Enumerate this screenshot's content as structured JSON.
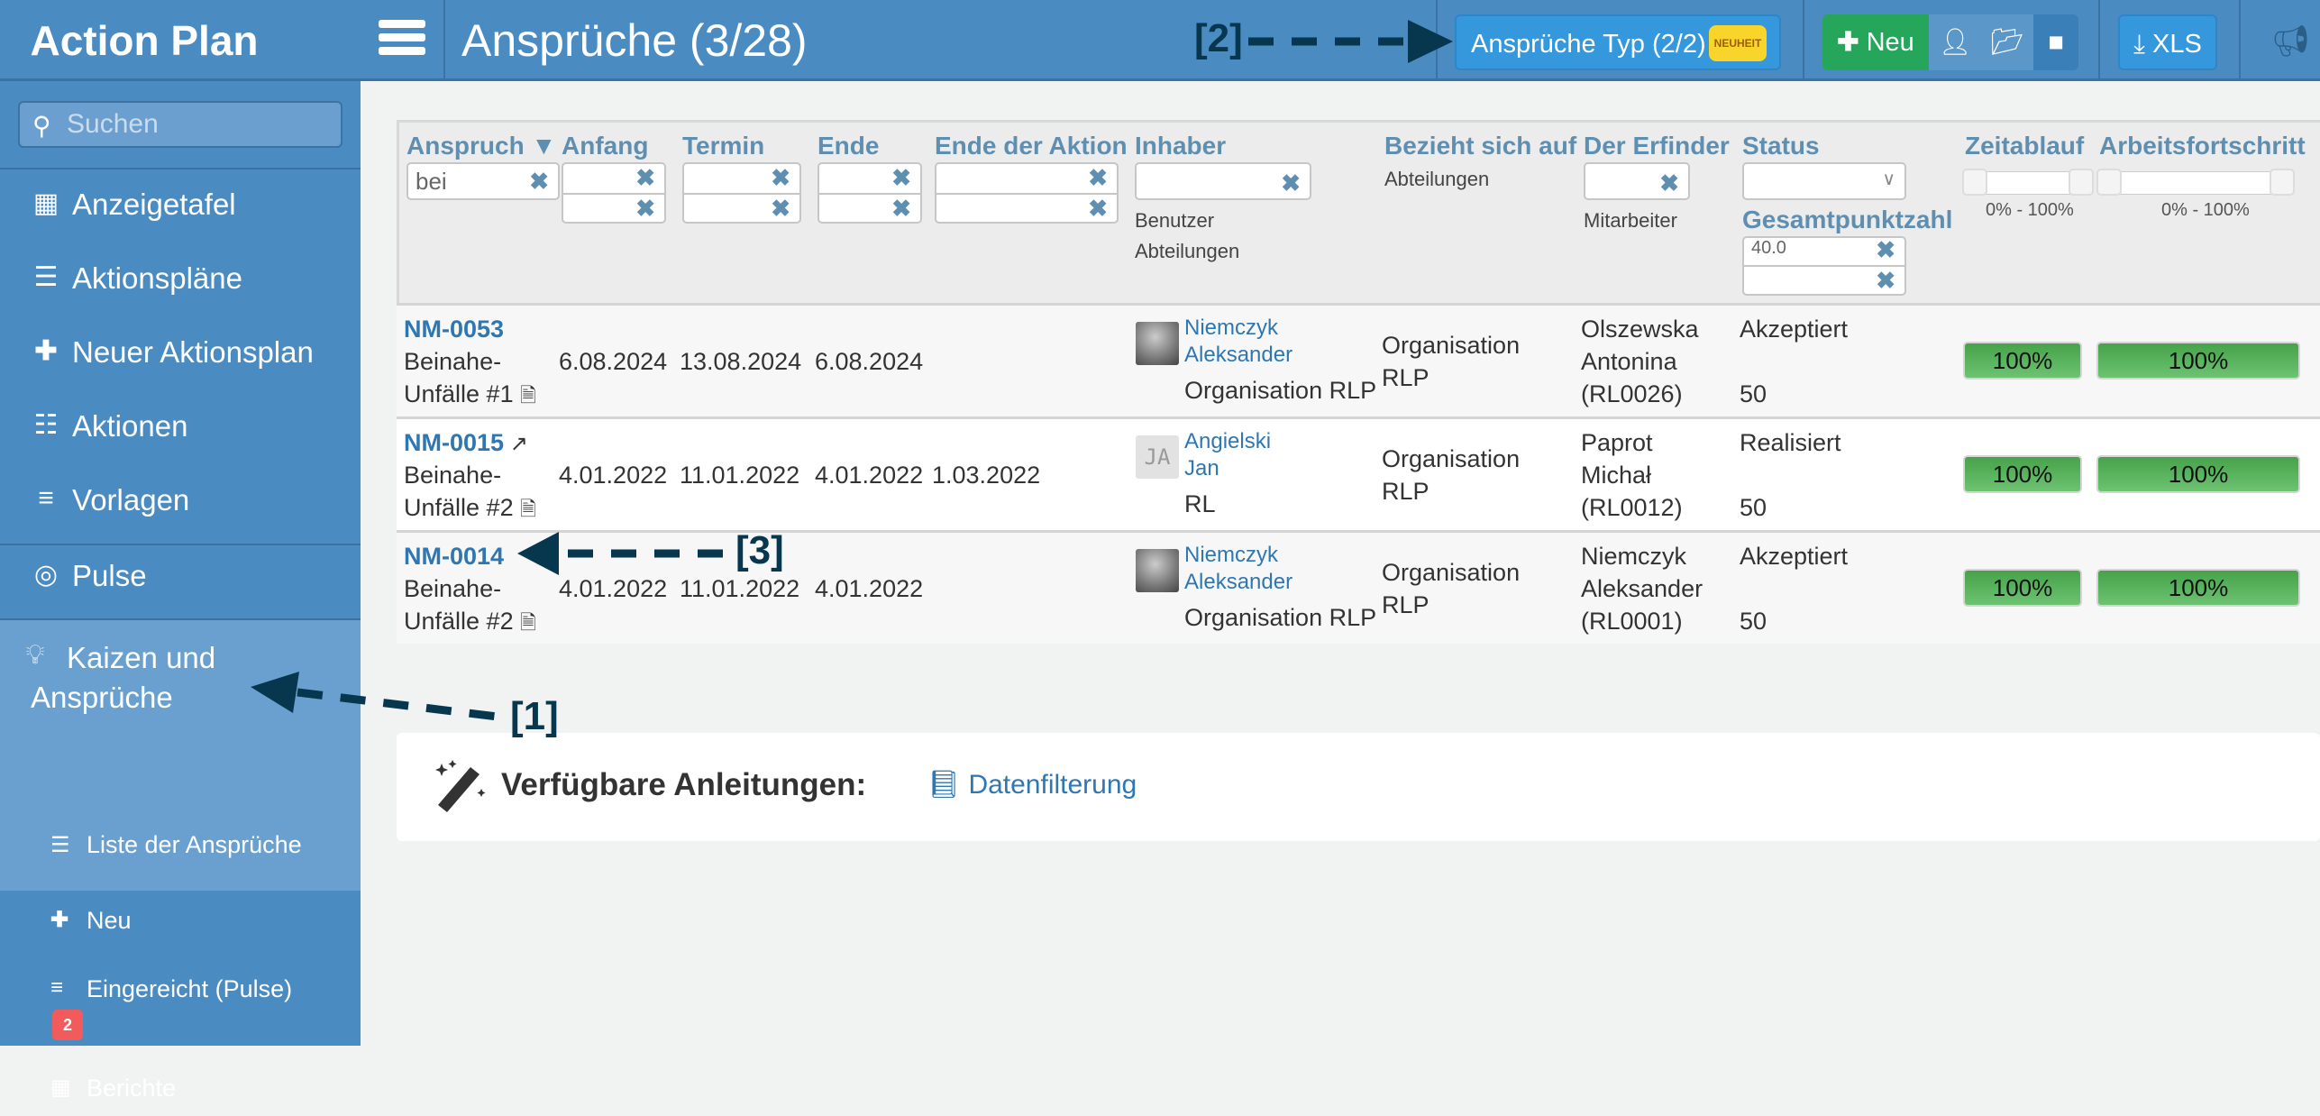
{
  "header": {
    "brand": "Action Plan",
    "page_title": "Ansprüche (3/28)",
    "type_button": "Ansprüche Typ (2/2)",
    "type_badge": "NEUHEIT",
    "new_button": "Neu",
    "xls_button": "XLS"
  },
  "sidebar": {
    "search_placeholder": "Suchen",
    "items": [
      {
        "label": "Anzeigetafel",
        "icon": "calendar-icon"
      },
      {
        "label": "Aktionspläne",
        "icon": "list-icon"
      },
      {
        "label": "Neuer Aktionsplan",
        "icon": "plus-icon"
      },
      {
        "label": "Aktionen",
        "icon": "sliders-icon"
      },
      {
        "label": "Vorlagen",
        "icon": "bars-icon"
      },
      {
        "label": "Pulse",
        "icon": "target-icon"
      },
      {
        "label": "Kaizen und Ansprüche",
        "icon": "lightbulb-icon"
      }
    ],
    "subitems": [
      {
        "label": "Liste der Ansprüche",
        "icon": "list-icon"
      },
      {
        "label": "Neu",
        "icon": "plus-icon"
      },
      {
        "label": "Eingereicht (Pulse)",
        "icon": "bars-icon",
        "badge": "2"
      },
      {
        "label": "Berichte",
        "icon": "table-icon"
      }
    ]
  },
  "table": {
    "columns": [
      "Anspruch ▼",
      "Anfang",
      "Termin",
      "Ende",
      "Ende der Aktion",
      "Inhaber",
      "Bezieht sich auf",
      "Der Erfinder",
      "Status",
      "Zeitablauf",
      "Arbeitsfortschritt"
    ],
    "filters": {
      "anspruch": "bei",
      "gesamtpunktzahl_label": "Gesamtpunktzahl",
      "gesamtpunktzahl_from": "40.0",
      "inhaber_sub1": "Benutzer",
      "inhaber_sub2": "Abteilungen",
      "bezieht_sub": "Abteilungen",
      "erfinder_sub": "Mitarbeiter",
      "zeitablauf_range": "0% - 100%",
      "arbeitsfortschritt_range": "0% - 100%"
    },
    "rows": [
      {
        "id": "NM-0053",
        "title_line1": "Beinahe-",
        "title_line2": "Unfälle #1",
        "anfang": "6.08.2024",
        "termin": "13.08.2024",
        "ende": "6.08.2024",
        "ende_aktion": "",
        "owner_last": "Niemczyk",
        "owner_first": "Aleksander",
        "owner_org": "Organisation RLP",
        "bezieht": "Organisation RLP",
        "inventor_line1": "Olszewska",
        "inventor_line2": "Antonina",
        "inventor_code": "(RL0026)",
        "status": "Akzeptiert",
        "score": "50",
        "time_progress": "100%",
        "work_progress": "100%"
      },
      {
        "id": "NM-0015",
        "title_line1": "Beinahe-",
        "title_line2": "Unfälle #2",
        "anfang": "4.01.2022",
        "termin": "11.01.2022",
        "ende": "4.01.2022",
        "ende_aktion": "1.03.2022",
        "owner_last": "Angielski",
        "owner_first": "Jan",
        "owner_org": "RL",
        "owner_initials": "JA",
        "bezieht": "Organisation RLP",
        "inventor_line1": "Paprot",
        "inventor_line2": "Michał",
        "inventor_code": "(RL0012)",
        "status": "Realisiert",
        "score": "50",
        "time_progress": "100%",
        "work_progress": "100%"
      },
      {
        "id": "NM-0014",
        "title_line1": "Beinahe-",
        "title_line2": "Unfälle #2",
        "anfang": "4.01.2022",
        "termin": "11.01.2022",
        "ende": "4.01.2022",
        "ende_aktion": "",
        "owner_last": "Niemczyk",
        "owner_first": "Aleksander",
        "owner_org": "Organisation RLP",
        "bezieht": "Organisation RLP",
        "inventor_line1": "Niemczyk",
        "inventor_line2": "Aleksander",
        "inventor_code": "(RL0001)",
        "status": "Akzeptiert",
        "score": "50",
        "time_progress": "100%",
        "work_progress": "100%"
      }
    ]
  },
  "guides": {
    "label": "Verfügbare Anleitungen:",
    "link": "Datenfilterung"
  },
  "annotations": [
    "[1]",
    "[2]",
    "[3]"
  ]
}
